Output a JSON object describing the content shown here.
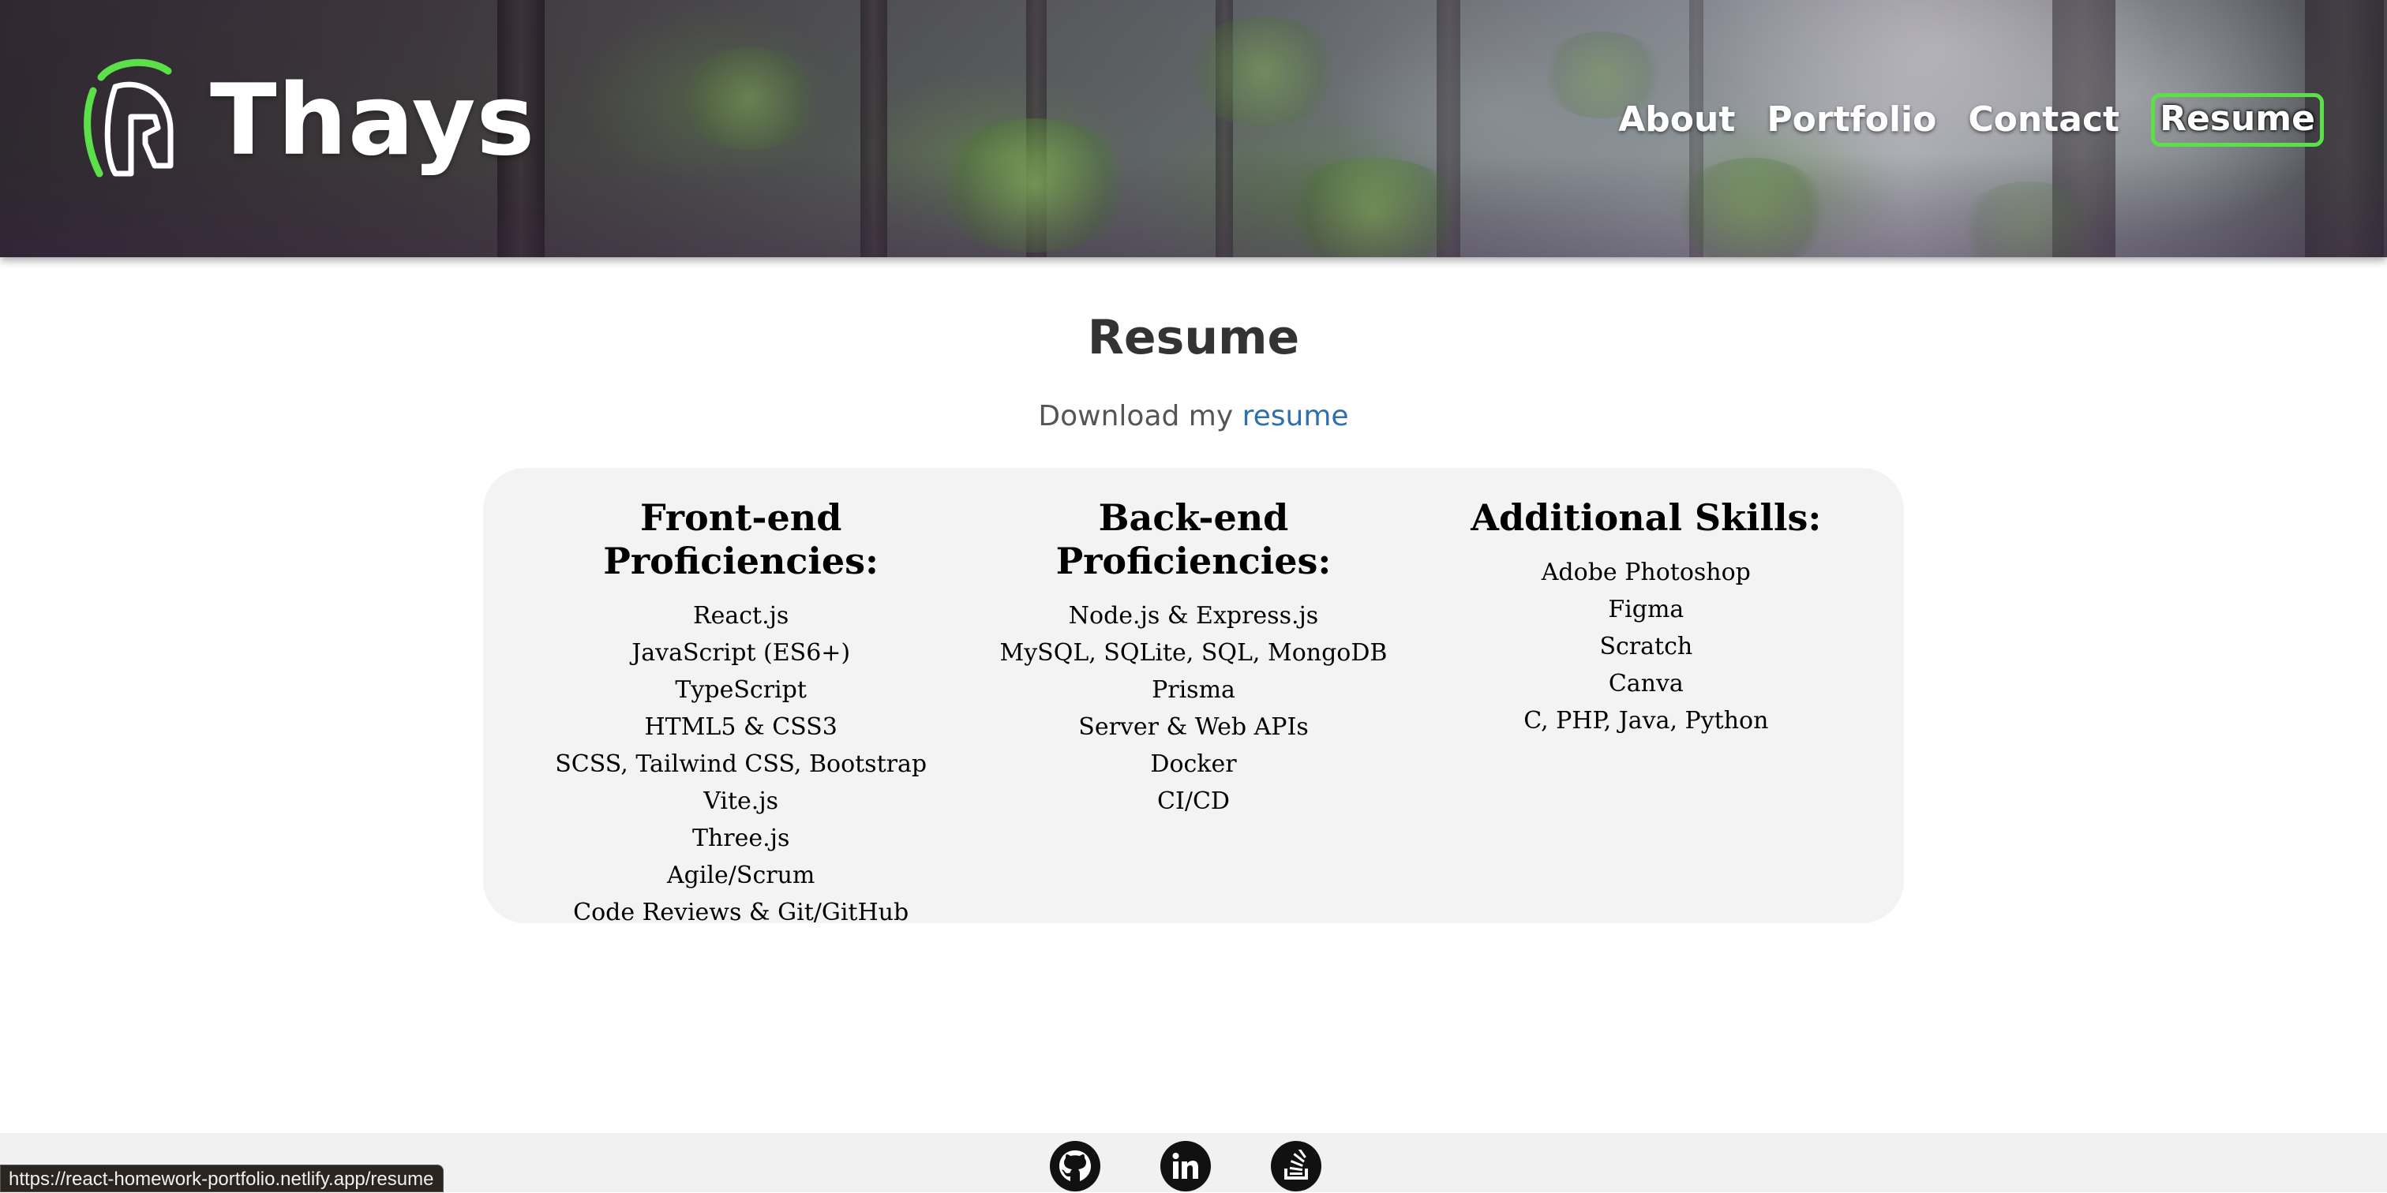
{
  "header": {
    "brand": "Thays",
    "nav": [
      {
        "label": "About",
        "active": false
      },
      {
        "label": "Portfolio",
        "active": false
      },
      {
        "label": "Contact",
        "active": false
      },
      {
        "label": "Resume",
        "active": true
      }
    ],
    "accent_color": "#5be04a"
  },
  "main": {
    "title": "Resume",
    "download_text": "Download my",
    "download_link_label": "resume",
    "link_color": "#2f6fb0",
    "columns": [
      {
        "heading": "Front-end Proficiencies:",
        "items": [
          "React.js",
          "JavaScript (ES6+)",
          "TypeScript",
          "HTML5 & CSS3",
          "SCSS, Tailwind CSS, Bootstrap",
          "Vite.js",
          "Three.js",
          "Agile/Scrum",
          "Code Reviews & Git/GitHub"
        ]
      },
      {
        "heading": "Back-end Proficiencies:",
        "items": [
          "Node.js & Express.js",
          "MySQL, SQLite, SQL, MongoDB",
          "Prisma",
          "Server & Web APIs",
          "Docker",
          "CI/CD"
        ]
      },
      {
        "heading": "Additional Skills:",
        "items": [
          "Adobe Photoshop",
          "Figma",
          "Scratch",
          "Canva",
          "C, PHP, Java, Python"
        ]
      }
    ]
  },
  "footer": {
    "social_icons": [
      "github-icon",
      "linkedin-icon",
      "stackoverflow-icon"
    ]
  },
  "status_bar": {
    "url": "https://react-homework-portfolio.netlify.app/resume"
  }
}
